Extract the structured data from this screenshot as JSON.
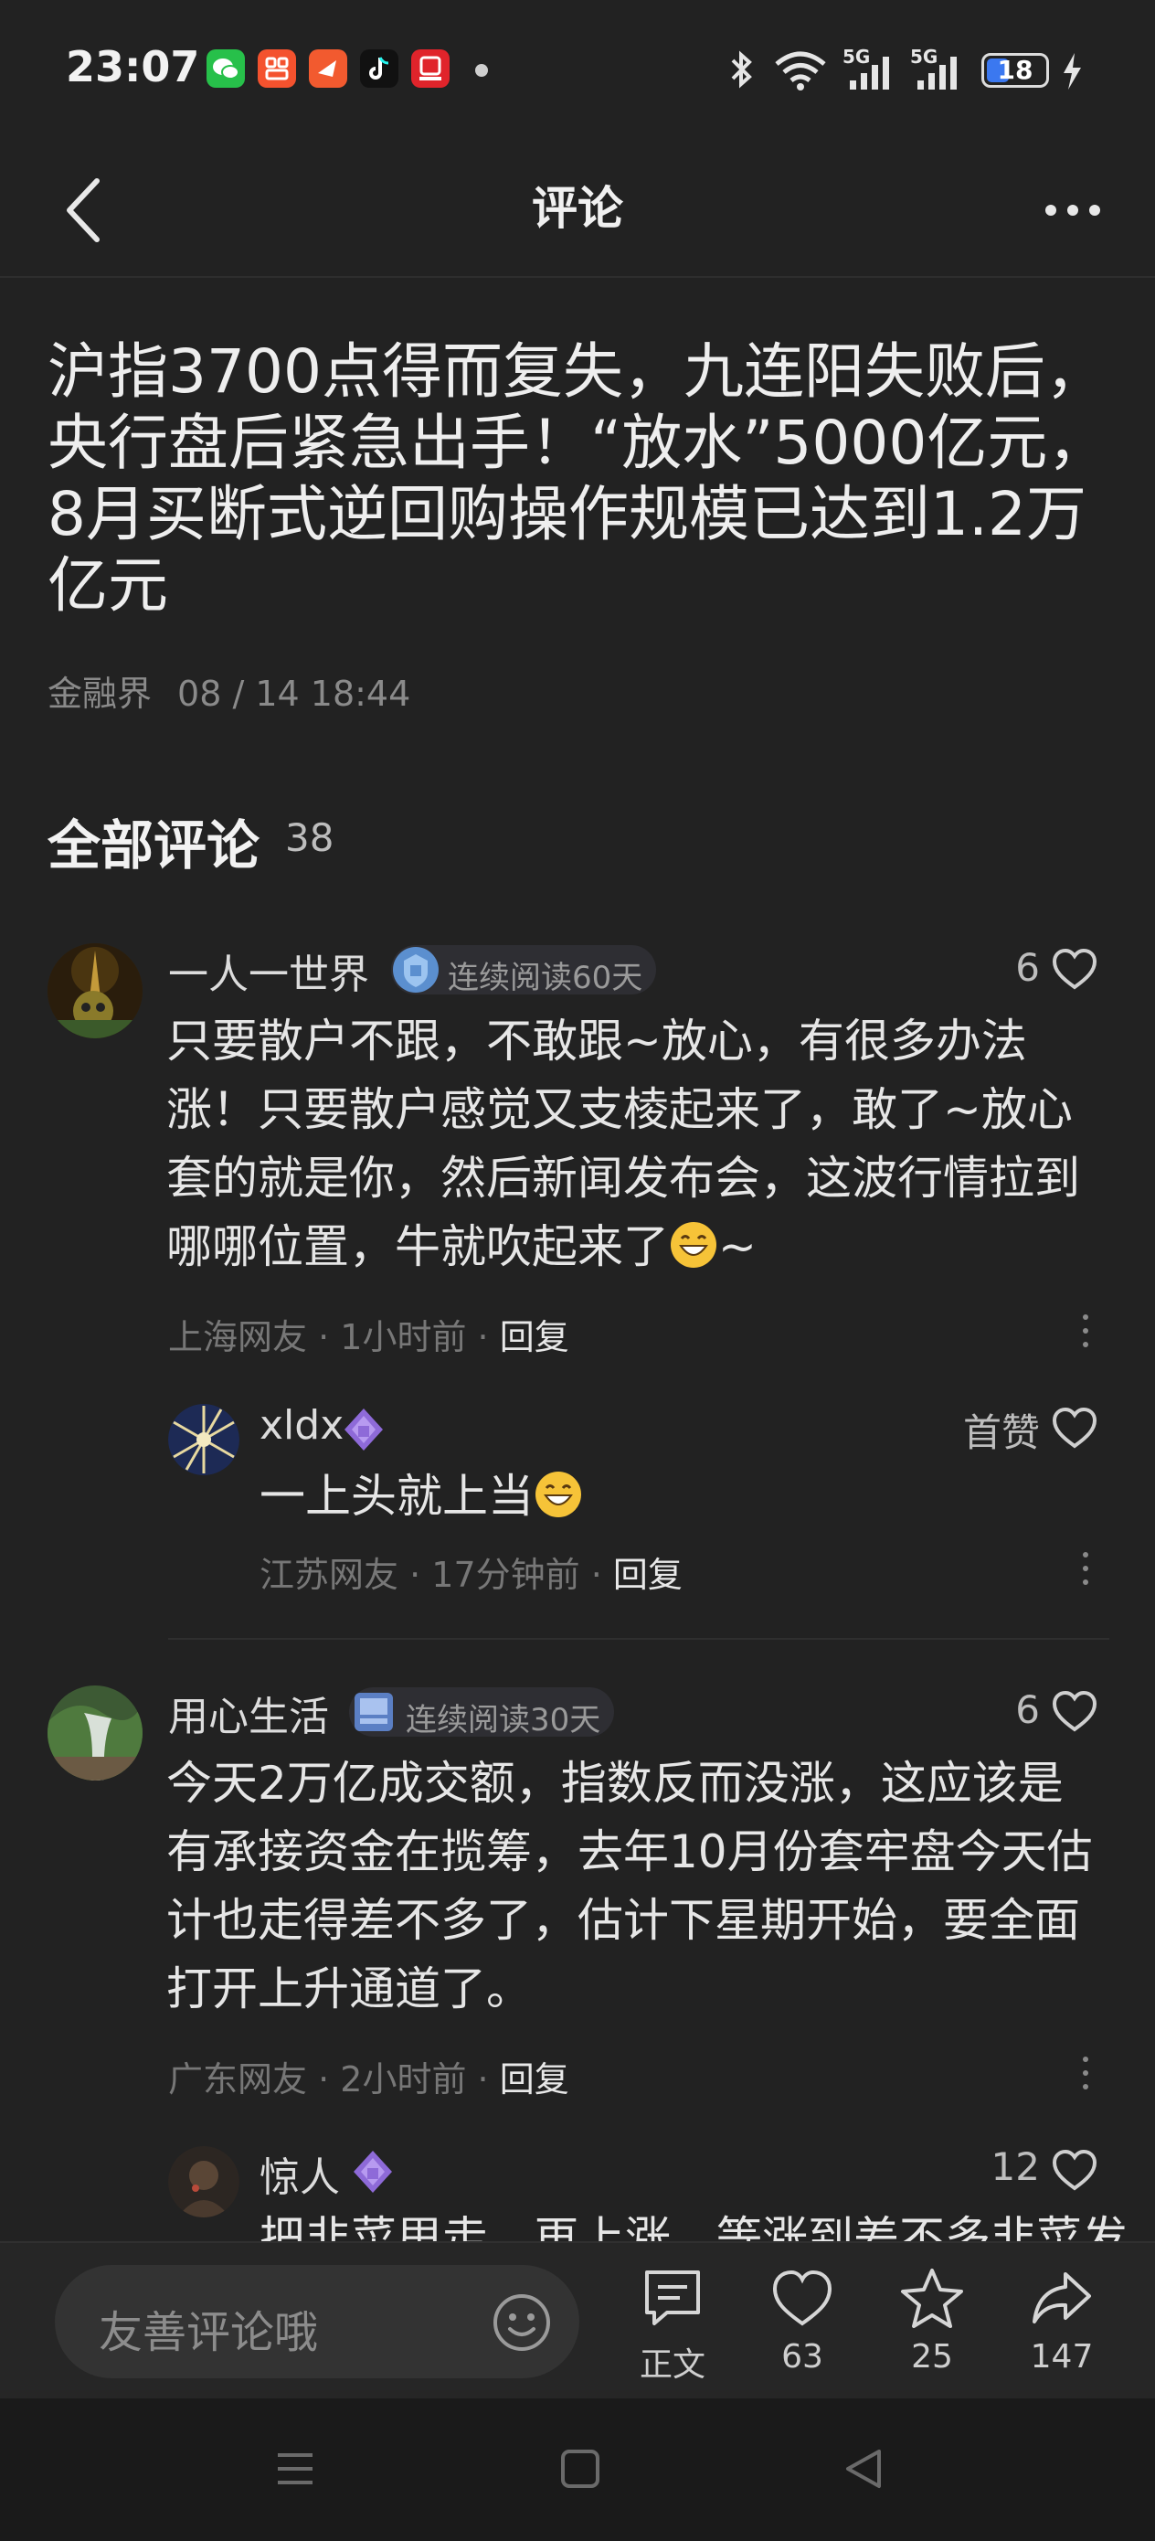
{
  "status_bar": {
    "time": "23:07",
    "battery": "18",
    "signal_label_1": "5G",
    "signal_label_2": "5G",
    "icons": [
      "wechat-icon",
      "app-icon",
      "message-app-icon",
      "tiktok-icon",
      "securities-app-icon",
      "bluetooth-icon",
      "wifi-icon",
      "signal-icon",
      "charging-icon"
    ]
  },
  "header": {
    "title": "评论"
  },
  "article": {
    "title": "沪指3700点得而复失，九连阳失败后，央行盘后紧急出手！“放水”5000亿元，8月买断式逆回购操作规模已达到1.2万亿元",
    "source": "金融界",
    "date": "08 / 14 18:44"
  },
  "comments_section": {
    "title": "全部评论",
    "count": "38"
  },
  "comments": [
    {
      "username": "一人一世界",
      "badge": "连续阅读60天",
      "likes": "6",
      "text": "只要散户不跟，不敢跟~放心，有很多办法涨！只要散户感觉又支棱起来了，敢了~放心套的就是你，然后新闻发布会，这波行情拉到哪哪位置，牛就吹起来了",
      "text_tail": "~",
      "location": "上海网友",
      "time": "1小时前",
      "reply": "回复",
      "replies": [
        {
          "username": "xldx",
          "likes": "首赞",
          "text": "一上头就上当",
          "location": "江苏网友",
          "time": "17分钟前",
          "reply": "回复"
        }
      ]
    },
    {
      "username": "用心生活",
      "badge": "连续阅读30天",
      "likes": "6",
      "text": "今天2万亿成交额，指数反而没涨，这应该是有承接资金在揽筹，去年10月份套牢盘今天估计也走得差不多了，估计下星期开始，要全面打开上升通道了。",
      "location": "广东网友",
      "time": "2小时前",
      "reply": "回复",
      "replies": [
        {
          "username": "惊人",
          "likes": "12",
          "text": "把韭菜甩走，再上涨，等涨到差不多韭菜发"
        }
      ]
    }
  ],
  "bottom_bar": {
    "input_placeholder": "友善评论哦",
    "actions": [
      {
        "label": "正文",
        "icon": "article-icon"
      },
      {
        "label": "63",
        "icon": "heart-icon"
      },
      {
        "label": "25",
        "icon": "star-icon"
      },
      {
        "label": "147",
        "icon": "share-icon"
      }
    ]
  },
  "nav_bar": {
    "icons": [
      "menu-icon",
      "home-square-icon",
      "back-triangle-icon"
    ]
  }
}
